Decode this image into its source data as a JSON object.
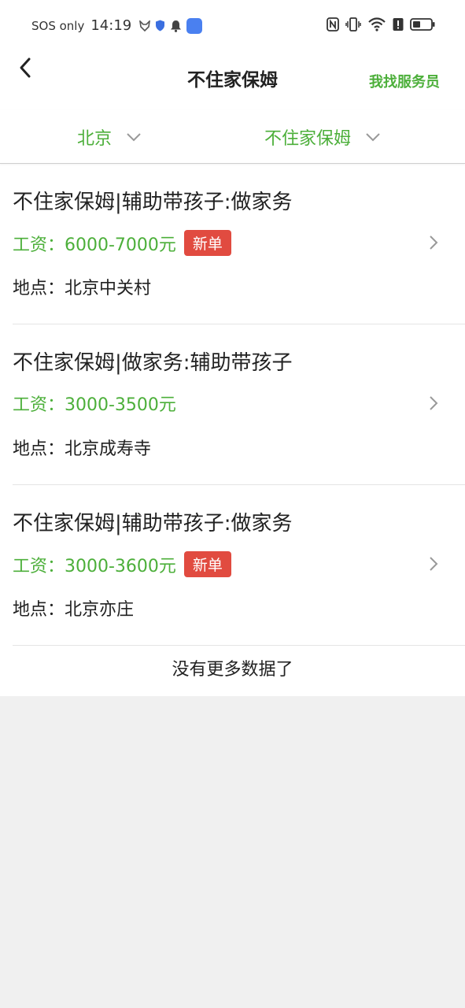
{
  "status_bar": {
    "sos": "SOS only",
    "time": "14:19",
    "icons": [
      "fox-icon",
      "shield-icon",
      "bell-icon",
      "app-icon",
      "nfc-icon",
      "vibrate-icon",
      "wifi-icon",
      "alert-icon",
      "battery-icon"
    ]
  },
  "nav": {
    "title": "不住家保姆",
    "find_link": "我找服务员"
  },
  "filters": {
    "city": "北京",
    "type": "不住家保姆"
  },
  "jobs": [
    {
      "title": "不住家保姆|辅助带孩子:做家务",
      "salary": "工资：6000-7000元",
      "badge": "新单",
      "location": "地点：北京中关村"
    },
    {
      "title": "不住家保姆|做家务:辅助带孩子",
      "salary": "工资：3000-3500元",
      "badge": "",
      "location": "地点：北京成寿寺"
    },
    {
      "title": "不住家保姆|辅助带孩子:做家务",
      "salary": "工资：3000-3600元",
      "badge": "新单",
      "location": "地点：北京亦庄"
    }
  ],
  "footer": {
    "no_more": "没有更多数据了"
  },
  "colors": {
    "accent": "#4caf3a",
    "badge": "#e14b40",
    "background": "#f0f0f0"
  }
}
